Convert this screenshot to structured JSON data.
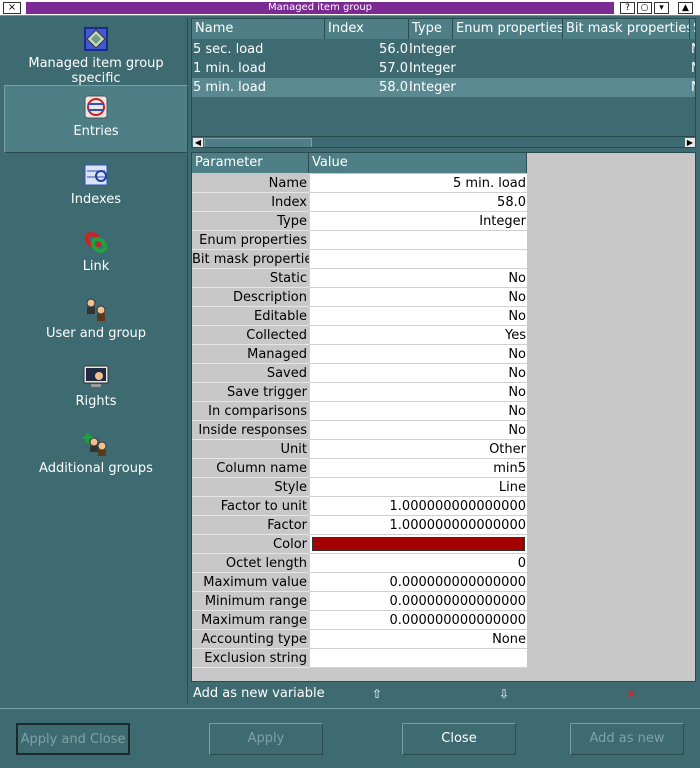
{
  "window": {
    "title": "Managed item group",
    "close_glyph": "×",
    "buttons": [
      "?",
      "○",
      "▾",
      "▲"
    ]
  },
  "sidebar": {
    "items": [
      {
        "label": "Managed item group specific",
        "icon": "diamond-icon"
      },
      {
        "label": "Entries",
        "icon": "entries-icon",
        "selected": true
      },
      {
        "label": "Indexes",
        "icon": "indexes-icon"
      },
      {
        "label": "Link",
        "icon": "link-icon"
      },
      {
        "label": "User and group",
        "icon": "user-group-icon"
      },
      {
        "label": "Rights",
        "icon": "rights-icon"
      },
      {
        "label": "Additional groups",
        "icon": "additional-groups-icon"
      }
    ]
  },
  "variables": {
    "columns": [
      "Name",
      "Index",
      "Type",
      "Enum properties",
      "Bit mask properties",
      "S"
    ],
    "rows": [
      {
        "name": "5 sec. load",
        "index": "56.0",
        "type": "Integer",
        "enum": "",
        "bitmask": "",
        "n": "N"
      },
      {
        "name": "1 min. load",
        "index": "57.0",
        "type": "Integer",
        "enum": "",
        "bitmask": "",
        "n": "N"
      },
      {
        "name": "5 min. load",
        "index": "58.0",
        "type": "Integer",
        "enum": "",
        "bitmask": "",
        "n": "N",
        "selected": true
      }
    ]
  },
  "parameters": {
    "columns": [
      "Parameter",
      "Value"
    ],
    "rows": [
      {
        "label": "Name",
        "value": "5 min. load"
      },
      {
        "label": "Index",
        "value": "58.0"
      },
      {
        "label": "Type",
        "value": "Integer"
      },
      {
        "label": "Enum properties",
        "value": ""
      },
      {
        "label": "Bit mask properties",
        "value": ""
      },
      {
        "label": "Static",
        "value": "No"
      },
      {
        "label": "Description",
        "value": "No"
      },
      {
        "label": "Editable",
        "value": "No"
      },
      {
        "label": "Collected",
        "value": "Yes"
      },
      {
        "label": "Managed",
        "value": "No"
      },
      {
        "label": "Saved",
        "value": "No"
      },
      {
        "label": "Save trigger",
        "value": "No"
      },
      {
        "label": "In comparisons",
        "value": "No"
      },
      {
        "label": "Inside responses",
        "value": "No"
      },
      {
        "label": "Unit",
        "value": "Other"
      },
      {
        "label": "Column name",
        "value": "min5"
      },
      {
        "label": "Style",
        "value": "Line"
      },
      {
        "label": "Factor to unit",
        "value": "1.000000000000000"
      },
      {
        "label": "Factor",
        "value": "1.000000000000000"
      },
      {
        "label": "Color",
        "value": "",
        "color": "#a50000"
      },
      {
        "label": "Octet length",
        "value": "0"
      },
      {
        "label": "Maximum value",
        "value": "0.000000000000000"
      },
      {
        "label": "Minimum range",
        "value": "0.000000000000000"
      },
      {
        "label": "Maximum range",
        "value": "0.000000000000000"
      },
      {
        "label": "Accounting type",
        "value": "None"
      },
      {
        "label": "Exclusion string",
        "value": ""
      }
    ]
  },
  "actions": {
    "add_new_variable": "Add as new variable",
    "move_up_glyph": "⇧",
    "move_down_glyph": "⇩",
    "delete_glyph": "✕",
    "delete_color": "#e02020"
  },
  "footer": {
    "apply_and_close": "Apply and Close",
    "apply": "Apply",
    "close": "Close",
    "add_as_new": "Add as new"
  }
}
